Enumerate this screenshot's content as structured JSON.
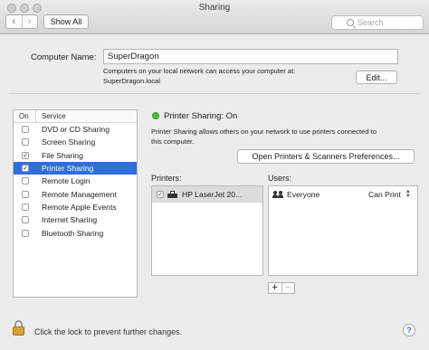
{
  "window": {
    "title": "Sharing",
    "nav_back": "‹",
    "nav_forward": "›",
    "show_all": "Show All",
    "search_placeholder": "Search"
  },
  "computer": {
    "name_label": "Computer Name:",
    "name_value": "SuperDragon",
    "help_line1": "Computers on your local network can access your computer at:",
    "help_line2": "SuperDragon.local",
    "edit_label": "Edit..."
  },
  "services": {
    "header_on": "On",
    "header_service": "Service",
    "items": [
      {
        "label": "DVD or CD Sharing",
        "checked": "",
        "selected": false
      },
      {
        "label": "Screen Sharing",
        "checked": "",
        "selected": false
      },
      {
        "label": "File Sharing",
        "checked": "✓",
        "selected": false
      },
      {
        "label": "Printer Sharing",
        "checked": "✓",
        "selected": true
      },
      {
        "label": "Remote Login",
        "checked": "",
        "selected": false
      },
      {
        "label": "Remote Management",
        "checked": "",
        "selected": false
      },
      {
        "label": "Remote Apple Events",
        "checked": "",
        "selected": false
      },
      {
        "label": "Internet Sharing",
        "checked": "",
        "selected": false
      },
      {
        "label": "Bluetooth Sharing",
        "checked": "",
        "selected": false
      }
    ]
  },
  "detail": {
    "status": "Printer Sharing: On",
    "status_color": "#4cbe3e",
    "description_line1": "Printer Sharing allows others on your network to use printers connected to",
    "description_line2": "this computer.",
    "open_prefs_label": "Open Printers & Scanners Preferences...",
    "printers_label": "Printers:",
    "users_label": "Users:",
    "printers": [
      {
        "name": "HP LaserJet 20...",
        "checked": "✓"
      }
    ],
    "users": [
      {
        "name": "Everyone",
        "permission": "Can Print"
      }
    ],
    "add_label": "+",
    "remove_label": "−"
  },
  "footer": {
    "lock_text": "Click the lock to prevent further changes.",
    "help_label": "?"
  },
  "colors": {
    "selection": "#2f6edc",
    "lock": "#d7a23b"
  }
}
